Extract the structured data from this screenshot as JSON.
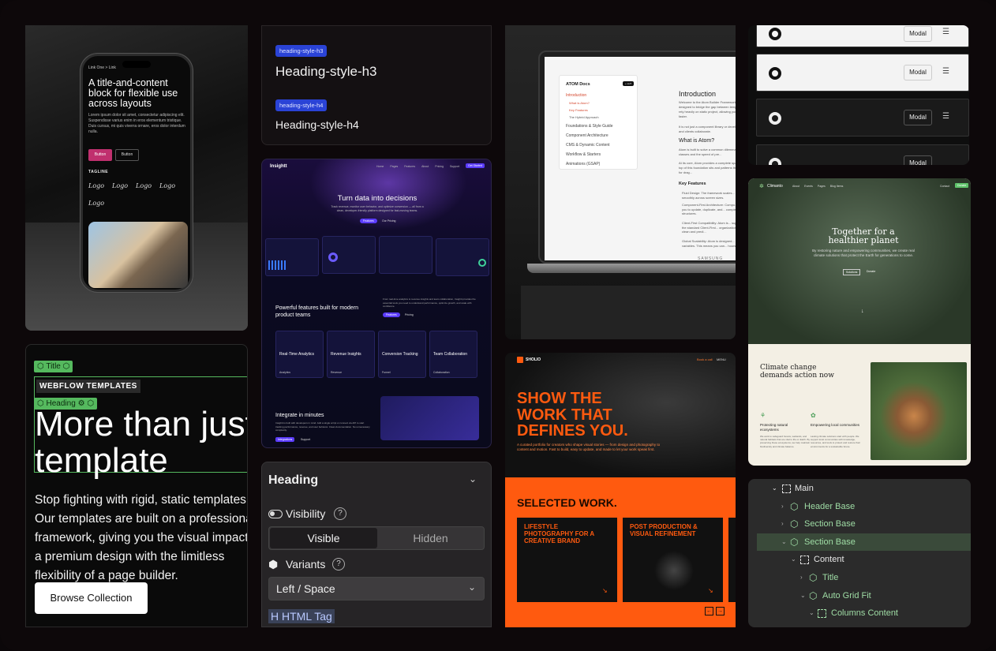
{
  "phone": {
    "crumb": "Link One  >  Link",
    "title": "A title-and-content block for flexible use across layouts",
    "paragraph": "Lorem ipsum dolor sit amet, consectetur adipiscing elit. Suspendisse varius enim in eros elementum tristique. Duis cursus, mi quis viverra ornare, eros dolor interdum nulla.",
    "button_primary": "Button",
    "button_secondary": "Button",
    "tagline": "TAGLINE",
    "logos": [
      "Logo",
      "Logo",
      "Logo",
      "Logo",
      "Logo"
    ]
  },
  "headings": {
    "h3_tag": "heading-style-h3",
    "h3_text": "Heading-style-h3",
    "h4_tag": "heading-style-h4",
    "h4_text": "Heading-style-h4"
  },
  "data_site": {
    "brand": "Insightt",
    "nav": [
      "Home",
      "Pages",
      "Features",
      "About",
      "Pricing",
      "Support"
    ],
    "nav_cta": "Get Started",
    "hero_title": "Turn data into decisions",
    "hero_sub": "Track revenue, monitor user behavior, and optimize conversion — all from a clean, developer-friendly platform designed for fast-moving teams.",
    "hero_cta1": "Features",
    "hero_cta2": "Our Pricing",
    "features_title": "Powerful features built for modern product teams",
    "features_sub": "From real-time analytics to revenue insights and team collaboration, Insightt provides the essential tools you need to understand performance, optimize growth, and scale with confidence.",
    "features_cta1": "Features",
    "features_cta2": "Pricing",
    "cards": [
      {
        "title": "Real-Time Analytics",
        "link": "Analytics"
      },
      {
        "title": "Revenue Insights",
        "link": "Revenue"
      },
      {
        "title": "Conversion Tracking",
        "link": "Funnel"
      },
      {
        "title": "Team Collaboration",
        "link": "Collaboration"
      }
    ],
    "integrate_title": "Integrate in minutes",
    "integrate_sub": "Insightt is built with developers in mind. Add a single script or connect via API to start tracking performance, revenue, and user behavior. Clean documentation. No unnecessary complexity.",
    "integrate_cta1": "Integrations",
    "integrate_cta2": "Support"
  },
  "panel": {
    "title": "Heading",
    "visibility_label": "Visibility",
    "visible": "Visible",
    "hidden": "Hidden",
    "variants_label": "Variants",
    "variant_value": "Left / Space",
    "html_tag": "HTML Tag"
  },
  "laptop": {
    "docs_title": "ATOM Docs",
    "docs_badge": "+ LHT",
    "menu": [
      "Introduction",
      "What is Atom?",
      "Key Features",
      "The Hybrid Approach",
      "Foundations & Style Guide",
      "Component Architecture",
      "CMS & Dynamic Content",
      "Workflow & Starters",
      "Animations (GSAP)"
    ],
    "intro_title": "Introduction",
    "intro_text": "Welcome to the Atom Builder Framework, designed to bridge the gap between templates that rely heavily on static project, allowing you to build faster.",
    "intro_text2": "It is not just a component library or developers, and clients collaborate.",
    "what_title": "What is Atom?",
    "what_text": "Atom is built to solve a common dilemma: custom classes and the speed of pre...",
    "what_text2": "At its core, Atom provides a complete spacing. On top of this foundation sits and patterns that allow for drag...",
    "key_title": "Key Features",
    "features": [
      "Fluid Design: The framework scales... adapt smoothly across screen sizes.",
      "Component-First Architecture: Compo... allows you to update, duplicate, and... complex class structures.",
      "Client-First Compatibility: Atom is... support to the standard Client-First... organization remain clean and predi...",
      "Global Scalability: Atom is designed... global variables. This means you can... hours."
    ],
    "brand": "SAMSUNG"
  },
  "orange": {
    "brand": "SHOLIO",
    "nav_cta": "Book a call",
    "nav_menu": "MENU",
    "hero_title": "SHOW THE WORK THAT DEFINES YOU.",
    "hero_sub": "A curated portfolio for creators who shape visual stories — from design and photography to content and motion. Fast to build, easy to update, and made to let your work speak first.",
    "section_title": "SELECTED WORK.",
    "works": [
      "LIFESTYLE PHOTOGRAPHY FOR A CREATIVE BRAND",
      "POST PRODUCTION & VISUAL REFINEMENT"
    ]
  },
  "modal_rows": {
    "label": "Modal"
  },
  "green_site": {
    "brand": "Climanto",
    "nav": [
      "About",
      "Events",
      "Pages",
      "Blog Items"
    ],
    "nav_contact": "Contact",
    "nav_cta": "Donate",
    "hero_title": "Together for a healthier planet",
    "hero_sub": "By restoring nature and empowering communities, we create real climate solutions that protect the Earth for generations to come.",
    "hero_cta1": "Solutions",
    "hero_cta2": "Donate",
    "section_title": "Climate change demands action now",
    "col1_title": "Protecting natural ecosystems",
    "col1_text": "We work to safeguard forests, wetlands, and natural habitats that are vital to life on Earth. By preserving these ecosystems, we help maintain biodiversity and climate balance.",
    "col2_title": "Empowering local communities",
    "col2_text": "Lasting climate solutions start with people. We support local communities with knowledge, resources, and tools to protect and restore their environments for a sustainable future."
  },
  "tree": {
    "items": [
      {
        "label": "Main",
        "level": 0,
        "type": "box"
      },
      {
        "label": "Header Base",
        "level": 1,
        "type": "cube"
      },
      {
        "label": "Section Base",
        "level": 1,
        "type": "cube"
      },
      {
        "label": "Section Base",
        "level": 1,
        "type": "cube",
        "selected": true
      },
      {
        "label": "Content",
        "level": 2,
        "type": "box"
      },
      {
        "label": "Title",
        "level": 3,
        "type": "cube"
      },
      {
        "label": "Auto Grid Fit",
        "level": 3,
        "type": "cube"
      },
      {
        "label": "Columns Content",
        "level": 4,
        "type": "box"
      }
    ]
  },
  "webflow": {
    "title_tag": "Title",
    "badge": "WEBFLOW TEMPLATES",
    "heading_tag": "Heading",
    "headline": "More than just a template",
    "paragraph": "Stop fighting with rigid, static templates. Our templates are built on a professional framework, giving you the visual impact of a premium design with the limitless flexibility of a page builder.",
    "cta": "Browse Collection"
  }
}
